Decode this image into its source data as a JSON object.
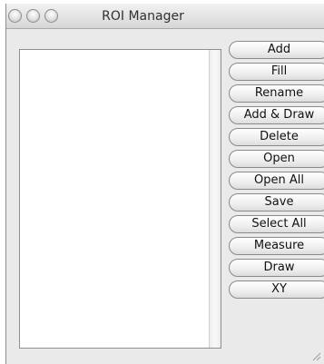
{
  "window": {
    "title": "ROI Manager"
  },
  "buttons": [
    {
      "name": "add-button",
      "label": "Add"
    },
    {
      "name": "fill-button",
      "label": "Fill"
    },
    {
      "name": "rename-button",
      "label": "Rename"
    },
    {
      "name": "add-draw-button",
      "label": "Add & Draw"
    },
    {
      "name": "delete-button",
      "label": "Delete"
    },
    {
      "name": "open-button",
      "label": "Open"
    },
    {
      "name": "open-all-button",
      "label": "Open All"
    },
    {
      "name": "save-button",
      "label": "Save"
    },
    {
      "name": "select-all-button",
      "label": "Select All"
    },
    {
      "name": "measure-button",
      "label": "Measure"
    },
    {
      "name": "draw-button",
      "label": "Draw"
    },
    {
      "name": "xy-button",
      "label": "XY"
    }
  ],
  "icons": {
    "close": "close-traffic-light-icon",
    "minimize": "minimize-traffic-light-icon",
    "zoom": "zoom-traffic-light-icon",
    "resize": "resize-grip-icon"
  }
}
